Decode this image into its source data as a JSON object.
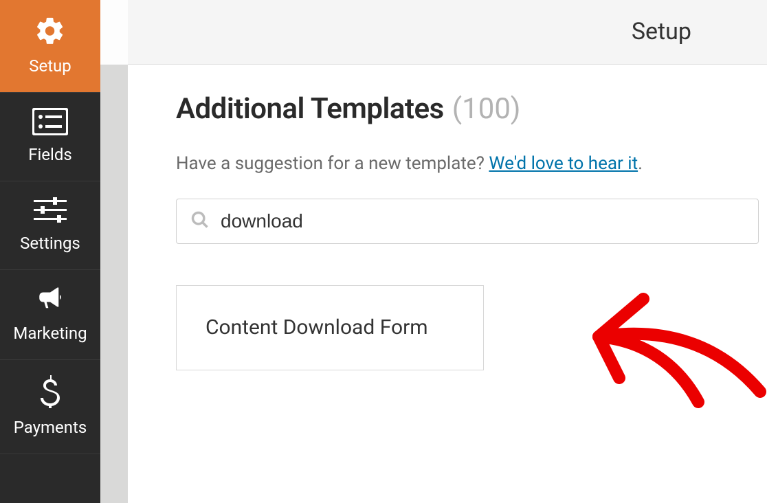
{
  "sidebar": {
    "items": [
      {
        "label": "Setup",
        "active": true
      },
      {
        "label": "Fields",
        "active": false
      },
      {
        "label": "Settings",
        "active": false
      },
      {
        "label": "Marketing",
        "active": false
      },
      {
        "label": "Payments",
        "active": false
      }
    ]
  },
  "header": {
    "title": "Setup"
  },
  "templates": {
    "heading": "Additional Templates",
    "count_label": "(100)",
    "suggestion_text": "Have a suggestion for a new template? ",
    "suggestion_link": "We'd love to hear it",
    "suggestion_period": "."
  },
  "search": {
    "value": "download"
  },
  "results": [
    {
      "title": "Content Download Form"
    }
  ]
}
